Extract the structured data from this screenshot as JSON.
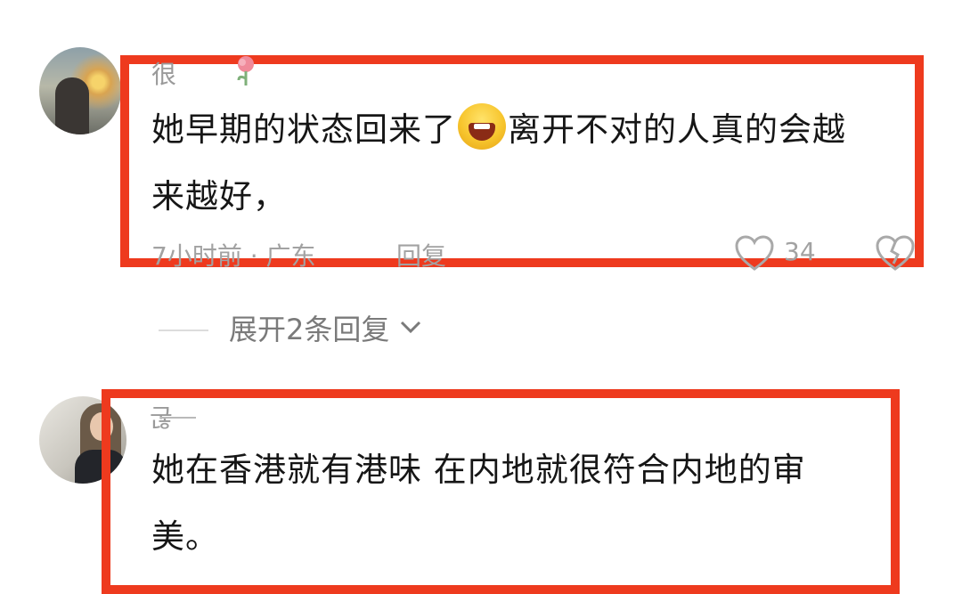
{
  "comments": [
    {
      "username": "很",
      "text_part1": "她早期的状态回来了",
      "text_part2": "离开不对的人真的会越",
      "text_part3": "来越好，",
      "meta": "7小时前 · 广东",
      "reply_label": "回复",
      "like_count": "34"
    },
    {
      "username": "굲",
      "text_part1": "她在香港就有港味 在内地就很符合内地的审",
      "text_part2": "美。"
    }
  ],
  "expand_replies": "展开2条回复",
  "icons": {
    "emoji": "laughing-emoji-icon",
    "like": "heart-icon",
    "dislike": "broken-heart-icon",
    "flower": "flower-icon",
    "chevron": "chevron-down-icon"
  },
  "colors": {
    "highlight_box": "#ee3a1e"
  }
}
